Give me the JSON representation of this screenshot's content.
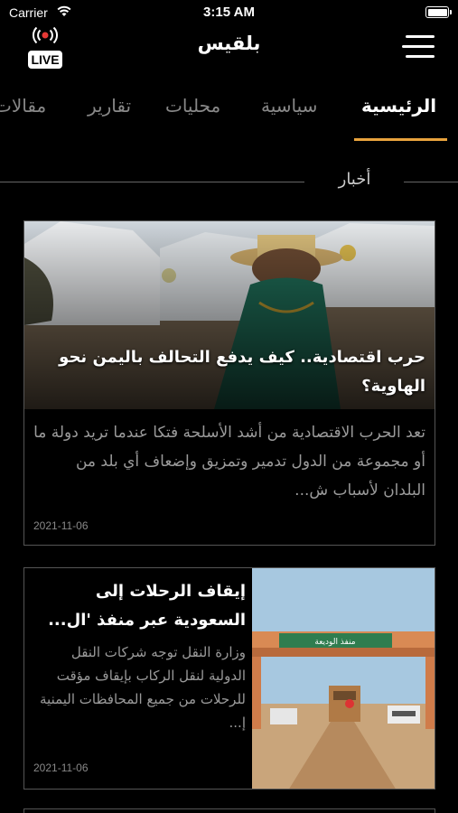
{
  "status_bar": {
    "carrier": "Carrier",
    "time": "3:15 AM",
    "wifi_icon": "wifi-icon",
    "battery_icon": "battery-icon"
  },
  "header": {
    "live_label": "LIVE",
    "title": "بلقيس",
    "menu_icon": "hamburger-menu-icon"
  },
  "tabs": [
    {
      "label": "الرئيسية",
      "active": true
    },
    {
      "label": "سياسية",
      "active": false
    },
    {
      "label": "محليات",
      "active": false
    },
    {
      "label": "تقارير",
      "active": false
    },
    {
      "label": "مقالات",
      "active": false
    }
  ],
  "section": {
    "title": "أخبار"
  },
  "articles": [
    {
      "headline": "حرب اقتصادية.. كيف يدفع التحالف باليمن نحو الهاوية؟",
      "excerpt": "تعد الحرب الاقتصادية من أشد الأسلحة فتكا عندما تريد دولة ما أو مجموعة من الدول تدمير وتمزيق وإضعاف أي بلد من البلدان لأسباب ش...",
      "date": "2021-11-06"
    },
    {
      "headline": "إيقاف الرحلات إلى السعودية عبر منفذ 'ال...",
      "excerpt": "وزارة النقل توجه شركات النقل الدولية لنقل الركاب بإيقاف مؤقت للرحلات من جميع المحافظات اليمنية إ...",
      "date": "2021-11-06",
      "image_sign": "منفذ الوديعة"
    }
  ],
  "colors": {
    "background": "#000000",
    "accent": "#e8a33d",
    "live_red": "#e53935"
  }
}
